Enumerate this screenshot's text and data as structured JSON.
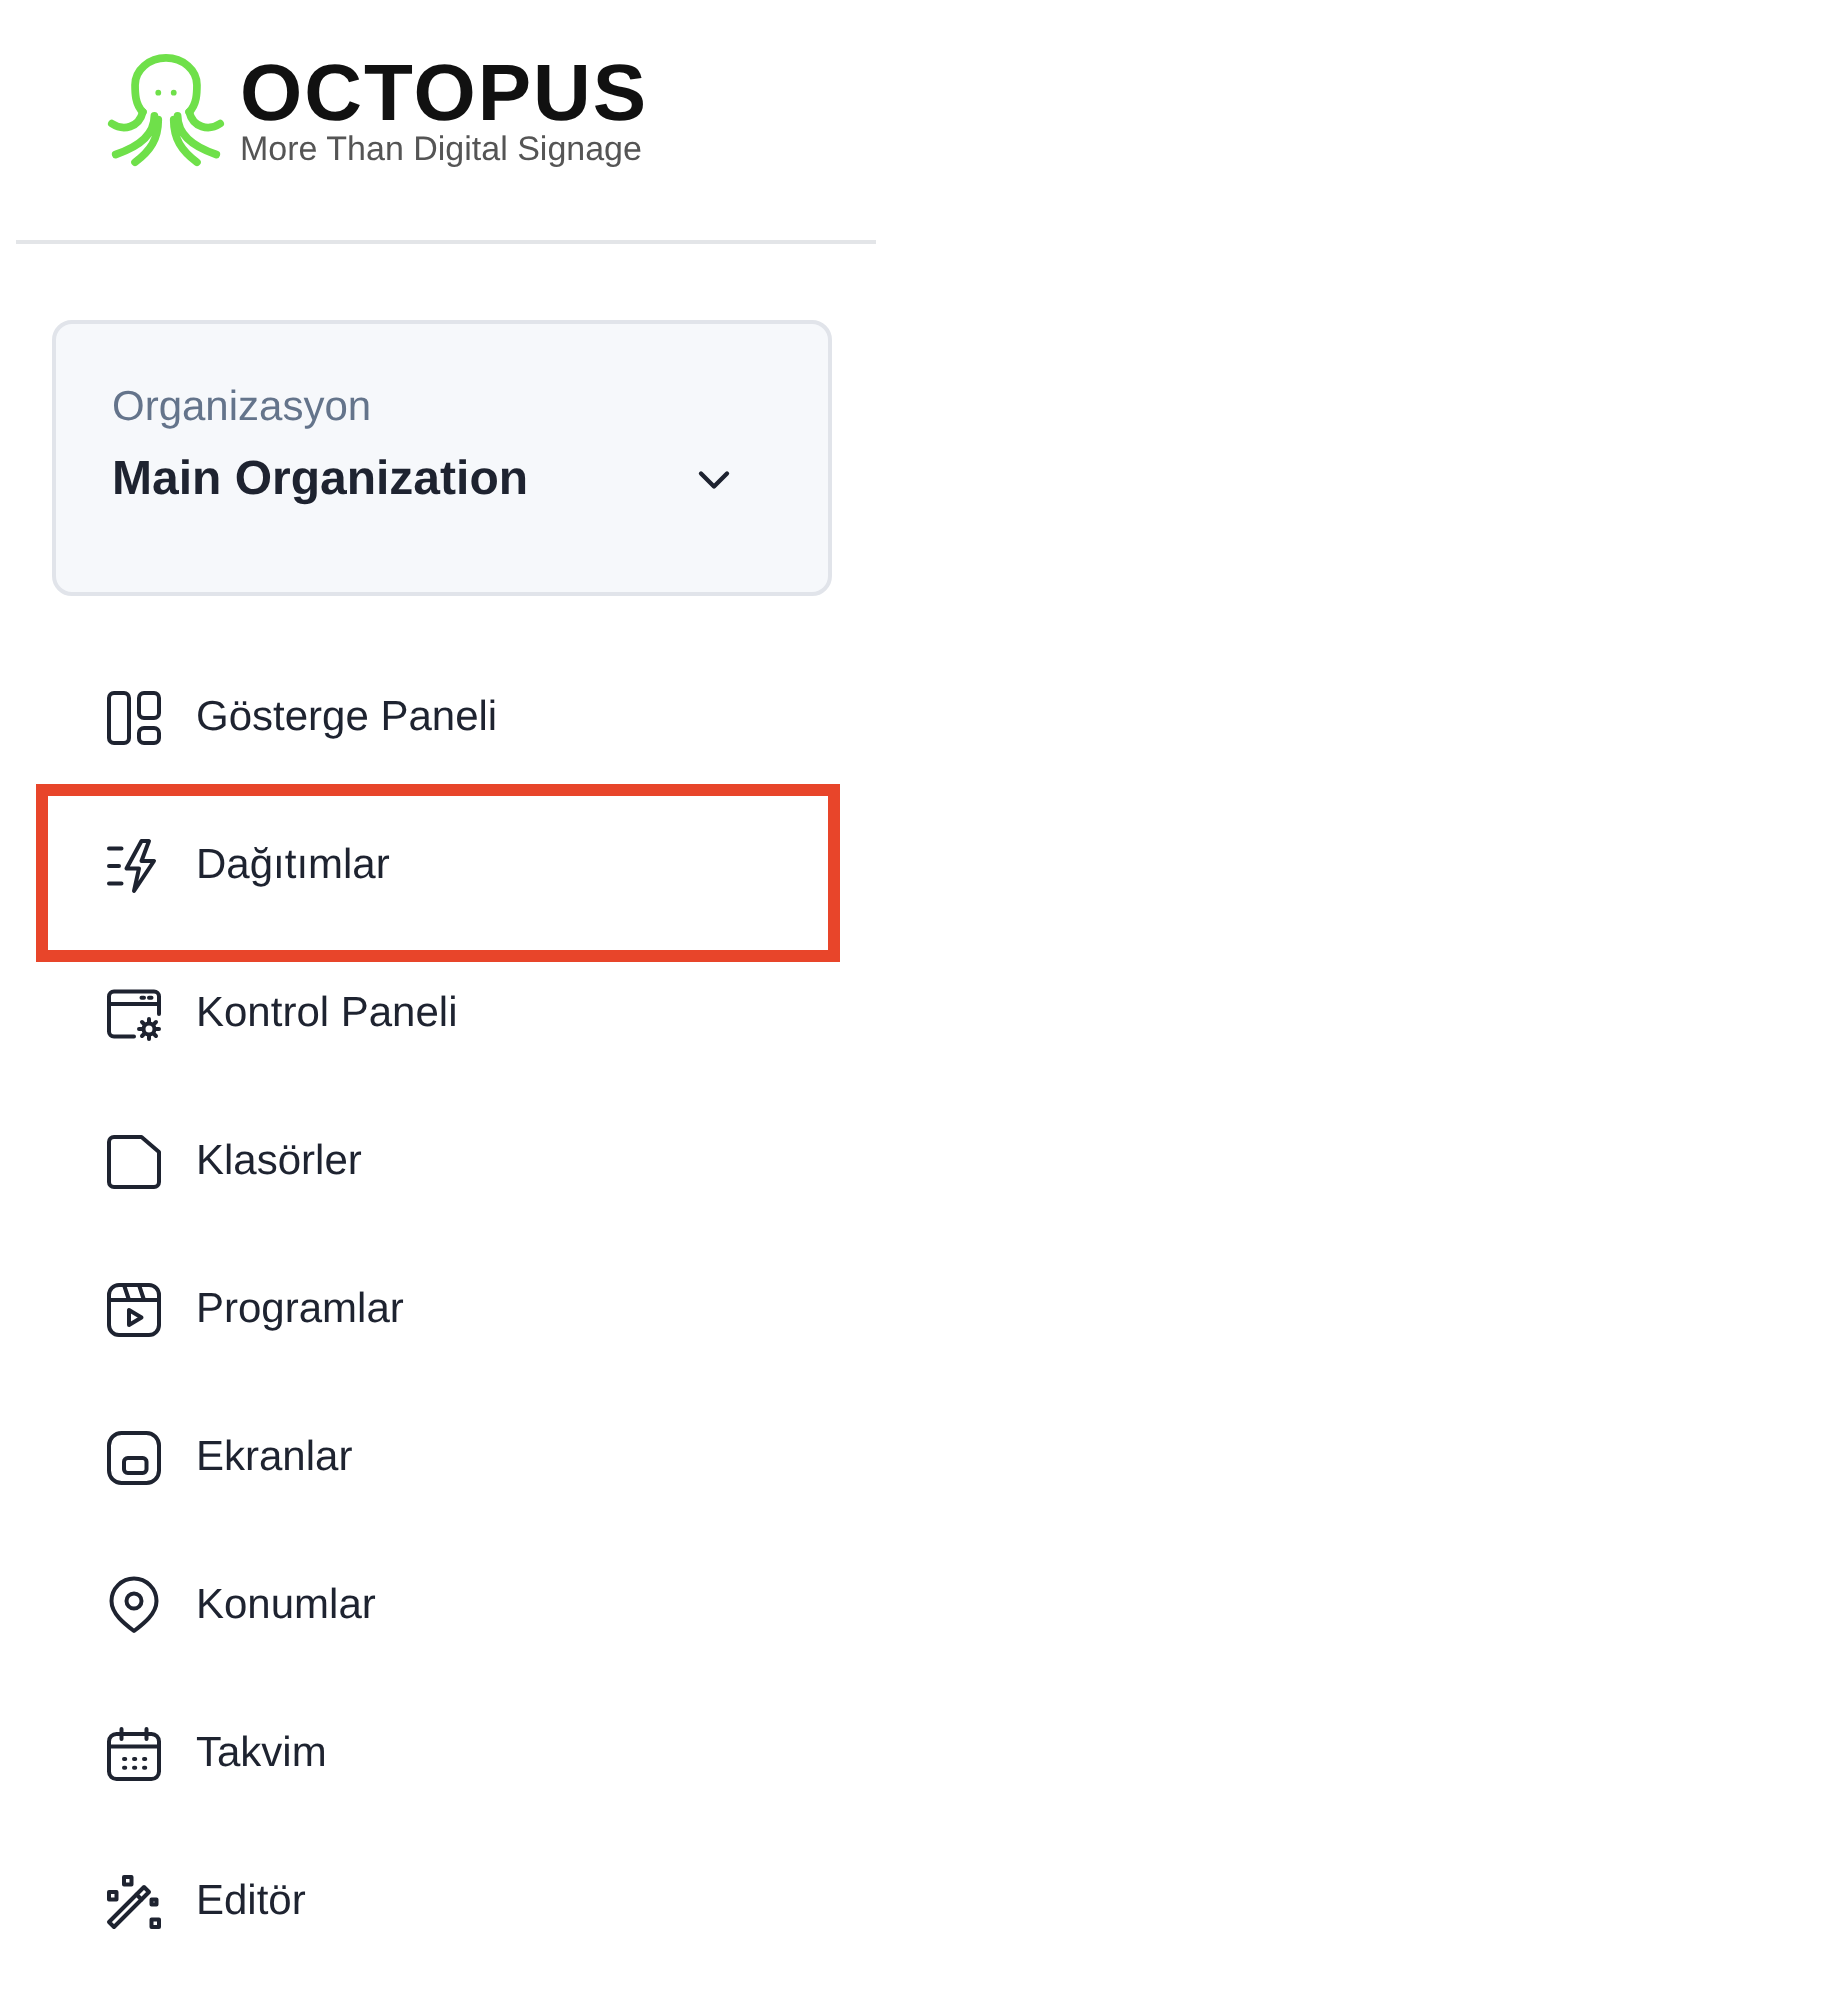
{
  "logo": {
    "name": "OCTOPUS",
    "tagline": "More Than Digital Signage"
  },
  "organization": {
    "label": "Organizasyon",
    "value": "Main Organization"
  },
  "nav": [
    {
      "label": "Gösterge Paneli",
      "kind": "layout",
      "highlighted": false
    },
    {
      "label": "Dağıtımlar",
      "kind": "bolt",
      "highlighted": true
    },
    {
      "label": "Kontrol Paneli",
      "kind": "window",
      "highlighted": false
    },
    {
      "label": "Klasörler",
      "kind": "folder",
      "highlighted": false
    },
    {
      "label": "Programlar",
      "kind": "video",
      "highlighted": false
    },
    {
      "label": "Ekranlar",
      "kind": "screen",
      "highlighted": false
    },
    {
      "label": "Konumlar",
      "kind": "pin",
      "highlighted": false
    },
    {
      "label": "Takvim",
      "kind": "calendar",
      "highlighted": false
    },
    {
      "label": "Editör",
      "kind": "wand",
      "highlighted": false
    }
  ]
}
